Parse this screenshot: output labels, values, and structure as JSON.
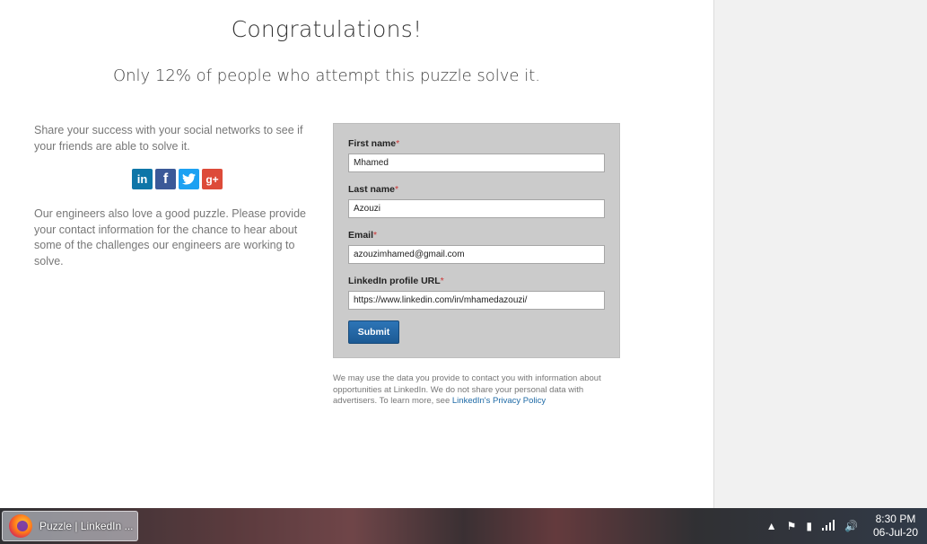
{
  "header": {
    "title": "Congratulations!",
    "subtitle": "Only 12% of people who attempt this puzzle solve it."
  },
  "share": {
    "text": "Share your success with your social networks to see if your friends are able to solve it.",
    "icons": [
      {
        "name": "linkedin-icon",
        "glyph": "in"
      },
      {
        "name": "facebook-icon",
        "glyph": "f"
      },
      {
        "name": "twitter-icon",
        "glyph": "🐦"
      },
      {
        "name": "googleplus-icon",
        "glyph": "g+"
      }
    ]
  },
  "engineers_text": "Our engineers also love a good puzzle. Please provide your contact information for the chance to hear about some of the challenges our engineers are working to solve.",
  "form": {
    "first_name": {
      "label": "First name",
      "value": "Mhamed"
    },
    "last_name": {
      "label": "Last name",
      "value": "Azouzi"
    },
    "email": {
      "label": "Email",
      "value": "azouzimhamed@gmail.com"
    },
    "linkedin_url": {
      "label": "LinkedIn profile URL",
      "value": "https://www.linkedin.com/in/mhamedazouzi/"
    },
    "required_mark": "*",
    "submit_label": "Submit"
  },
  "disclaimer": {
    "text": "We may use the data you provide to contact you with information about opportunities at LinkedIn. We do not share your personal data with advertisers. To learn more, see ",
    "link": "LinkedIn's Privacy Policy"
  },
  "taskbar": {
    "app_label": "Puzzle | LinkedIn ...",
    "time": "8:30 PM",
    "date": "06-Jul-20"
  }
}
